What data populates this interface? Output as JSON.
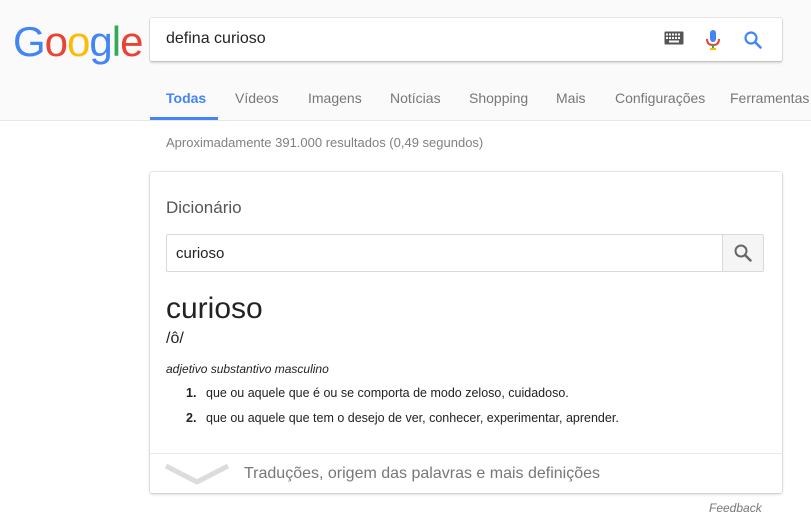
{
  "logo": {
    "letters": [
      "G",
      "o",
      "o",
      "g",
      "l",
      "e"
    ],
    "colors": [
      "#4285f4",
      "#ea4335",
      "#fbbc05",
      "#4285f4",
      "#34a853",
      "#ea4335"
    ]
  },
  "search": {
    "query": "defina curioso",
    "icons": [
      "keyboard-icon",
      "microphone-icon",
      "search-icon"
    ]
  },
  "tabs": [
    {
      "label": "Todas",
      "active": true
    },
    {
      "label": "Vídeos"
    },
    {
      "label": "Imagens"
    },
    {
      "label": "Notícias"
    },
    {
      "label": "Shopping"
    },
    {
      "label": "Mais"
    },
    {
      "label": "Configurações"
    },
    {
      "label": "Ferramentas"
    }
  ],
  "results_stats": "Aproximadamente 391.000 resultados (0,49 segundos)",
  "dictionary": {
    "title": "Dicionário",
    "search_value": "curioso",
    "word": "curioso",
    "phonetic": "/ô/",
    "part_of_speech": "adjetivo substantivo masculino",
    "definitions": [
      {
        "num": "1.",
        "text": "que ou aquele que é ou se comporta de modo zeloso, cuidadoso."
      },
      {
        "num": "2.",
        "text": "que ou aquele que tem o desejo de ver, conhecer, experimentar, aprender."
      }
    ],
    "more_link": "Traduções, origem das palavras e mais definições"
  },
  "feedback": "Feedback",
  "colors": {
    "accent": "#4285f4",
    "header_bg": "#fafafa"
  }
}
